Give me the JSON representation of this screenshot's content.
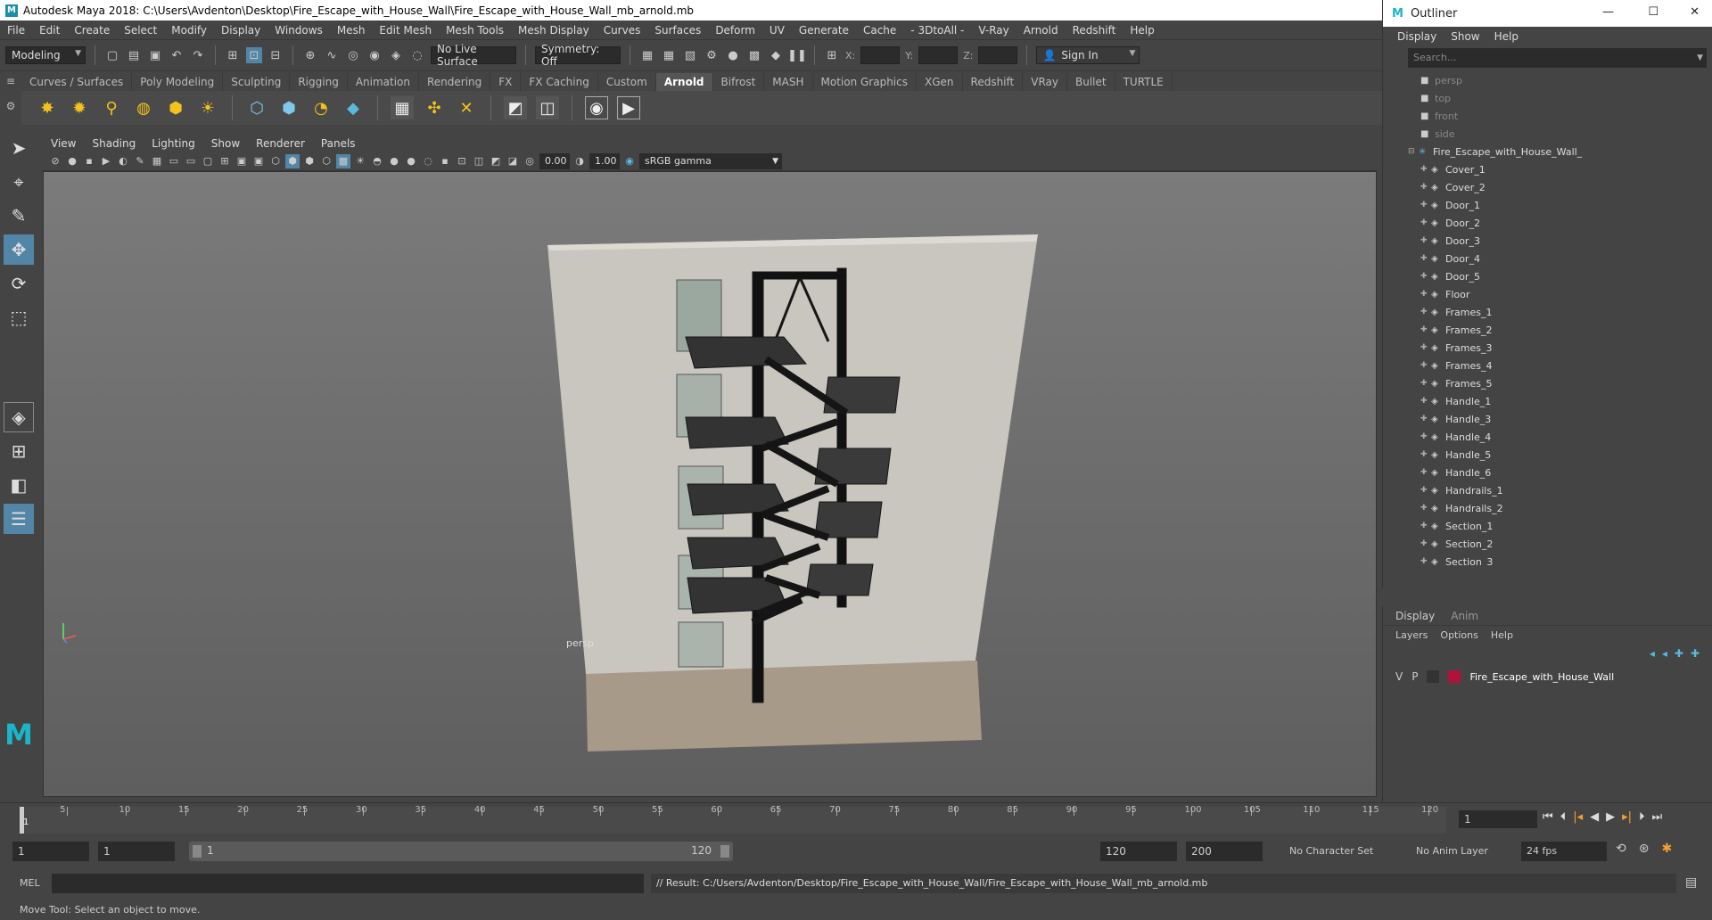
{
  "window": {
    "title": "Autodesk Maya 2018: C:\\Users\\Avdenton\\Desktop\\Fire_Escape_with_House_Wall\\Fire_Escape_with_House_Wall_mb_arnold.mb"
  },
  "menubar": [
    "File",
    "Edit",
    "Create",
    "Select",
    "Modify",
    "Display",
    "Windows",
    "Mesh",
    "Edit Mesh",
    "Mesh Tools",
    "Mesh Display",
    "Curves",
    "Surfaces",
    "Deform",
    "UV",
    "Generate",
    "Cache",
    "- 3DtoAll -",
    "V-Ray",
    "Arnold",
    "Redshift",
    "Help"
  ],
  "statusline": {
    "mode": "Modeling",
    "live_surface": "No Live Surface",
    "symmetry": "Symmetry: Off",
    "x_label": "X:",
    "y_label": "Y:",
    "z_label": "Z:",
    "sign_in": "Sign In"
  },
  "shelf_tabs": [
    "Curves / Surfaces",
    "Poly Modeling",
    "Sculpting",
    "Rigging",
    "Animation",
    "Rendering",
    "FX",
    "FX Caching",
    "Custom",
    "Arnold",
    "Bifrost",
    "MASH",
    "Motion Graphics",
    "XGen",
    "Redshift",
    "VRay",
    "Bullet",
    "TURTLE"
  ],
  "active_shelf": "Arnold",
  "viewport": {
    "menus": [
      "View",
      "Shading",
      "Lighting",
      "Show",
      "Renderer",
      "Panels"
    ],
    "exposure": "0.00",
    "gamma": "1.00",
    "color_space": "sRGB gamma",
    "camera_label": "persp"
  },
  "outliner": {
    "title": "Outliner",
    "menus": [
      "Display",
      "Show",
      "Help"
    ],
    "search_placeholder": "Search...",
    "cameras": [
      "persp",
      "top",
      "front",
      "side"
    ],
    "group": "Fire_Escape_with_House_Wall_",
    "children": [
      "Cover_1",
      "Cover_2",
      "Door_1",
      "Door_2",
      "Door_3",
      "Door_4",
      "Door_5",
      "Floor",
      "Frames_1",
      "Frames_2",
      "Frames_3",
      "Frames_4",
      "Frames_5",
      "Handle_1",
      "Handle_3",
      "Handle_4",
      "Handle_5",
      "Handle_6",
      "Handrails_1",
      "Handrails_2",
      "Section_1",
      "Section_2",
      "Section_3"
    ]
  },
  "layer_editor": {
    "tabs": [
      "Display",
      "Anim"
    ],
    "menus": [
      "Layers",
      "Options",
      "Help"
    ],
    "layer": {
      "v": "V",
      "p": "P",
      "name": "Fire_Escape_with_House_Wall",
      "color": "#b0133a"
    }
  },
  "timeline": {
    "ticks": [
      "5",
      "10",
      "15",
      "20",
      "25",
      "30",
      "35",
      "40",
      "45",
      "50",
      "55",
      "60",
      "65",
      "70",
      "75",
      "80",
      "85",
      "90",
      "95",
      "100",
      "105",
      "110",
      "115",
      "120"
    ],
    "current_frame": "1",
    "first_tick": "1"
  },
  "range": {
    "start": "1",
    "start2": "1",
    "slider_start": "1",
    "slider_end": "120",
    "end": "120",
    "end2": "200",
    "character_set": "No Character Set",
    "anim_layer": "No Anim Layer",
    "fps": "24 fps"
  },
  "cmdline": {
    "label": "MEL",
    "result": "// Result: C:/Users/Avdenton/Desktop/Fire_Escape_with_House_Wall/Fire_Escape_with_House_Wall_mb_arnold.mb"
  },
  "helpline": "Move Tool: Select an object to move."
}
